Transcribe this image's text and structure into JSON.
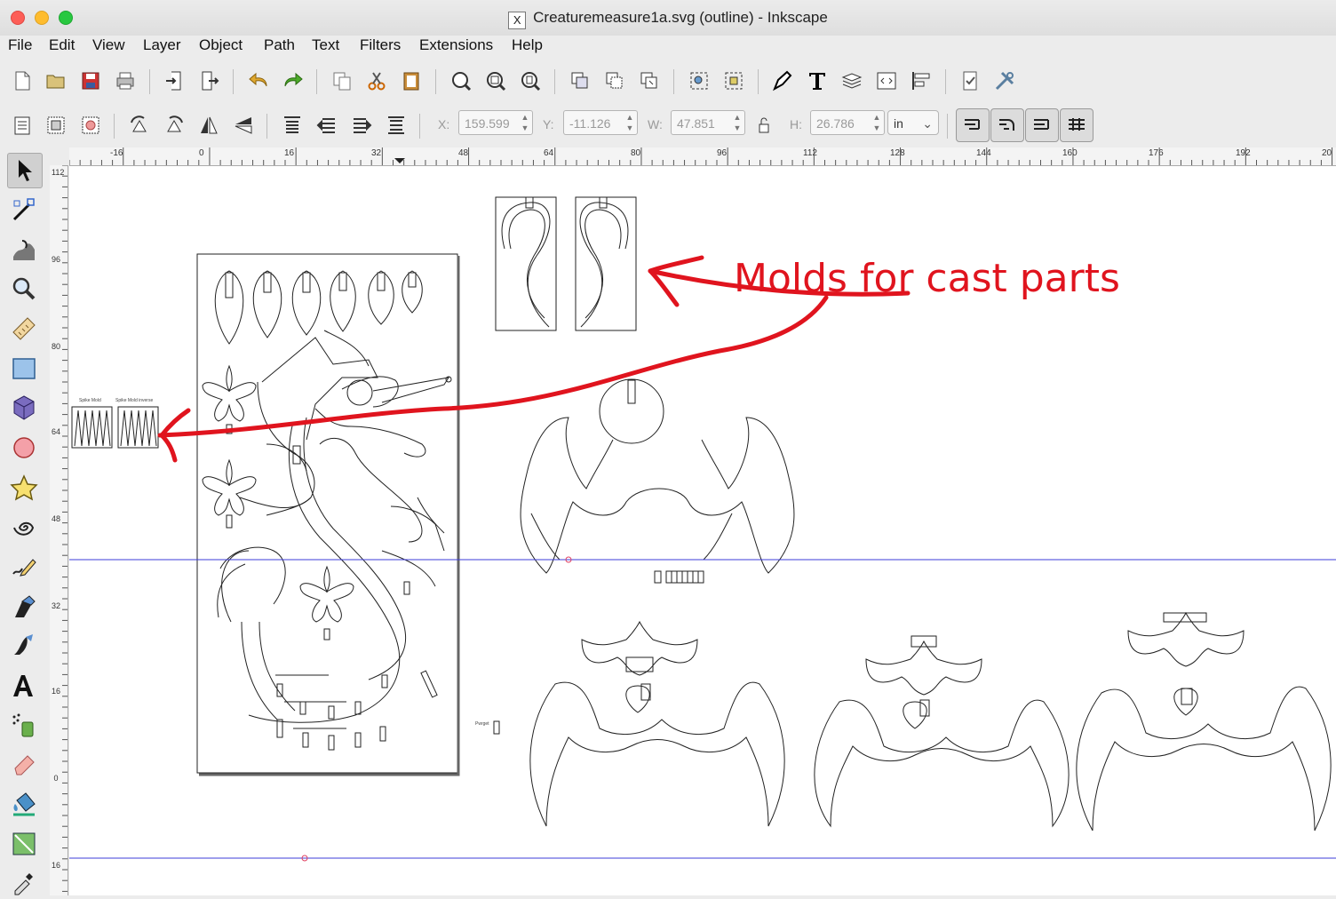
{
  "window": {
    "title": "Creaturemeasure1a.svg (outline) - Inkscape"
  },
  "menu": [
    "File",
    "Edit",
    "View",
    "Layer",
    "Object",
    "Path",
    "Text",
    "Filters",
    "Extensions",
    "Help"
  ],
  "toolbar_icons": [
    "new-document-icon",
    "open-icon",
    "save-icon",
    "print-icon",
    "import-icon",
    "export-icon",
    "undo-icon",
    "redo-icon",
    "copy-icon",
    "cut-icon",
    "paste-icon",
    "zoom-selection-icon",
    "zoom-drawing-icon",
    "zoom-page-icon",
    "duplicate-icon",
    "clone-icon",
    "unlink-clone-icon",
    "group-icon",
    "ungroup-icon",
    "fill-stroke-icon",
    "text-font-icon",
    "layers-icon",
    "xml-editor-icon",
    "align-distribute-icon",
    "document-properties-icon",
    "preferences-icon"
  ],
  "transform": {
    "x_label": "X:",
    "x_value": "159.599",
    "y_label": "Y:",
    "y_value": "-11.126",
    "w_label": "W:",
    "w_value": "47.851",
    "h_label": "H:",
    "h_value": "26.786",
    "unit": "in"
  },
  "tools": [
    "selector-tool-icon",
    "node-tool-icon",
    "tweak-tool-icon",
    "zoom-tool-icon",
    "measure-tool-icon",
    "rectangle-tool-icon",
    "box-3d-tool-icon",
    "ellipse-tool-icon",
    "star-tool-icon",
    "spiral-tool-icon",
    "pencil-tool-icon",
    "pen-tool-icon",
    "calligraphy-tool-icon",
    "text-tool-icon",
    "spray-tool-icon",
    "eraser-tool-icon",
    "paint-bucket-tool-icon",
    "gradient-tool-icon",
    "dropper-tool-icon"
  ],
  "ruler": {
    "h_ticks": [
      "-16",
      "0",
      "16",
      "32",
      "48",
      "64",
      "80",
      "96",
      "112",
      "128",
      "144",
      "160",
      "176",
      "192",
      "20"
    ],
    "v_ticks": [
      "112",
      "96",
      "80",
      "64",
      "48",
      "32",
      "16",
      "0",
      "16"
    ]
  },
  "canvas": {
    "spike_mold_label": "Spike Mold",
    "spike_mold_inverse_label": "Spike Mold inverse",
    "small_part_label": "Pwrget",
    "annotation": "Molds for cast parts",
    "annotation_color": "#e0141e"
  }
}
